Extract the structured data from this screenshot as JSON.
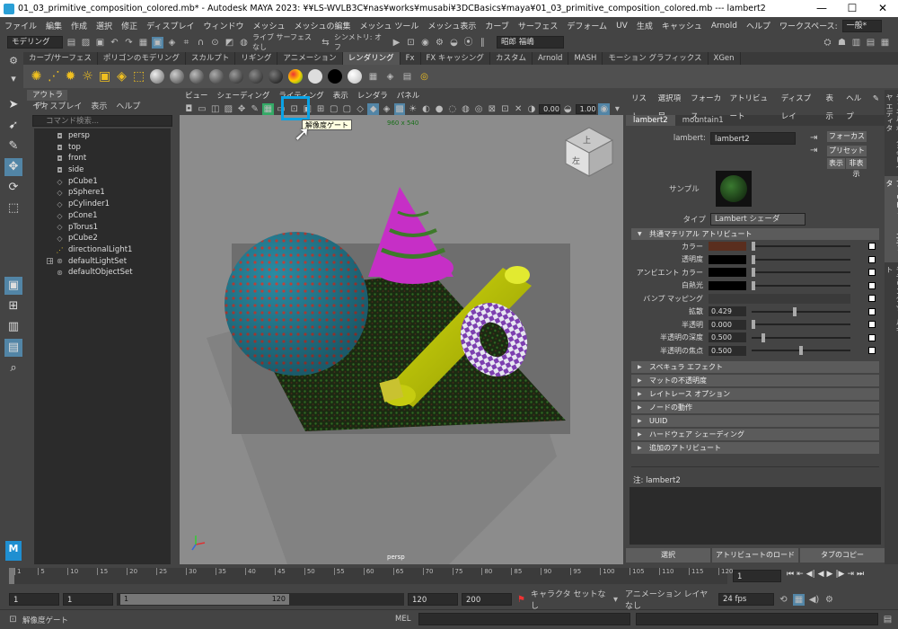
{
  "title_bar": {
    "text": "01_03_primitive_composition_colored.mb* - Autodesk MAYA 2023: ¥¥LS-WVLB3C¥nas¥works¥musabi¥3DCBasics¥maya¥01_03_primitive_composition_colored.mb   ---   lambert2"
  },
  "menu": [
    "ファイル",
    "編集",
    "作成",
    "選択",
    "修正",
    "ディスプレイ",
    "ウィンドウ",
    "メッシュ",
    "メッシュの編集",
    "メッシュ ツール",
    "メッシュ表示",
    "カーブ",
    "サーフェス",
    "デフォーム",
    "UV",
    "生成",
    "キャッシュ",
    "Arnold",
    "ヘルプ"
  ],
  "workspace": {
    "label": "ワークスペース:",
    "value": "一般*"
  },
  "status_line": {
    "mode": "モデリング",
    "symmetry": "シンメトリ: オフ",
    "live": "ライブ サーフェスなし",
    "user": "昭郎 福嶋"
  },
  "shelf_tabs": [
    "カーブ/サーフェス",
    "ポリゴンのモデリング",
    "スカルプト",
    "リギング",
    "アニメーション",
    "レンダリング",
    "Fx",
    "FX キャッシング",
    "カスタム",
    "Arnold",
    "MASH",
    "モーション グラフィックス",
    "XGen"
  ],
  "shelf_active": "レンダリング",
  "outliner": {
    "title": "アウトライナ",
    "menu": [
      "ディスプレイ",
      "表示",
      "ヘルプ"
    ],
    "search_placeholder": "コマンド検索...",
    "items": [
      "persp",
      "top",
      "front",
      "side",
      "pCube1",
      "pSphere1",
      "pCylinder1",
      "pCone1",
      "pTorus1",
      "pCube2",
      "directionalLight1",
      "defaultLightSet",
      "defaultObjectSet"
    ]
  },
  "viewport": {
    "menu": [
      "ビュー",
      "シェーディング",
      "ライティング",
      "表示",
      "レンダラ",
      "パネル"
    ],
    "resolution": "960 x 540",
    "camera": "persp",
    "field1": "0.00",
    "field2": "1.00",
    "tooltip": "解像度ゲート",
    "viewcube_labels": [
      "上",
      "左"
    ]
  },
  "attr_editor": {
    "menu": [
      "リスト",
      "選択項目",
      "フォーカス",
      "アトリビュート",
      "ディスプレイ",
      "表示",
      "ヘルプ"
    ],
    "tabs": [
      "lambert2",
      "mountain1"
    ],
    "name_label": "lambert:",
    "name_value": "lambert2",
    "btn_focus": "フォーカス",
    "btn_preset": "プリセット",
    "btn_show": "表示",
    "btn_hide": "非表示",
    "sample_label": "サンプル",
    "type_label": "タイプ",
    "type_value": "Lambert シェーダ",
    "common_section": "共通マテリアル アトリビュート",
    "attrs": [
      {
        "label": "カラー",
        "kind": "color",
        "color": "#5a2e1e"
      },
      {
        "label": "透明度",
        "kind": "color",
        "color": "#000000"
      },
      {
        "label": "アンビエント カラー",
        "kind": "color",
        "color": "#000000"
      },
      {
        "label": "白熱光",
        "kind": "color",
        "color": "#000000"
      },
      {
        "label": "バンプ マッピング",
        "kind": "empty",
        "value": ""
      },
      {
        "label": "拡散",
        "kind": "num",
        "value": "0.429",
        "level": 0.43
      },
      {
        "label": "半透明",
        "kind": "num",
        "value": "0.000",
        "level": 0.0
      },
      {
        "label": "半透明の深度",
        "kind": "num",
        "value": "0.500",
        "level": 0.1
      },
      {
        "label": "半透明の焦点",
        "kind": "num",
        "value": "0.500",
        "level": 0.5
      }
    ],
    "sections": [
      "スペキュラ エフェクト",
      "マットの不透明度",
      "レイトレース オプション",
      "ノードの動作",
      "UUID",
      "ハードウェア シェーディング",
      "追加のアトリビュート"
    ],
    "notes_label": "注:  lambert2",
    "bottom_buttons": [
      "選択",
      "アトリビュートのロード",
      "タブのコピー"
    ]
  },
  "side_tabs": [
    "チャネル ボックス/レイヤ エディタ",
    "アトリビュート エディタ",
    "モデリング ツールキット"
  ],
  "timeline": {
    "ticks": [
      "1",
      "5",
      "10",
      "15",
      "20",
      "25",
      "30",
      "35",
      "40",
      "45",
      "50",
      "55",
      "60",
      "65",
      "70",
      "75",
      "80",
      "85",
      "90",
      "95",
      "100",
      "105",
      "110",
      "115",
      "120"
    ],
    "current_frame": "1"
  },
  "range": {
    "start": "1",
    "start2": "1",
    "slider_start": "1",
    "slider_end": "120",
    "end": "120",
    "end2": "200",
    "char_set": "キャラクタ セットなし",
    "anim_layer": "アニメーション レイヤなし",
    "fps": "24 fps"
  },
  "help_line": {
    "text": "解像度ゲート",
    "mel": "MEL"
  }
}
